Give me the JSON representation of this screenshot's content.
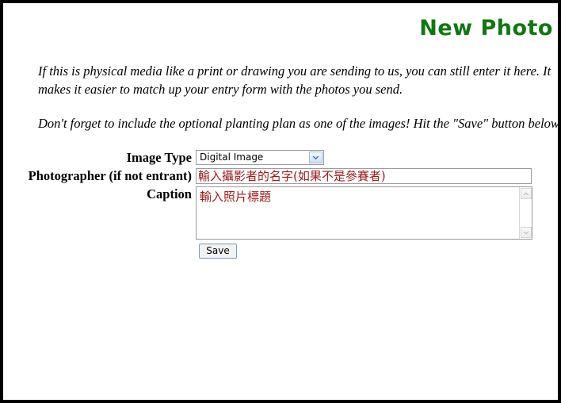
{
  "page": {
    "title": "New Photo",
    "title_color": "#117711",
    "frame_color": "#000000"
  },
  "intro": {
    "paragraph_1": "If this is physical media like a print or drawing you are sending to us, you can still enter it here. It makes it easier to match up your entry form with the photos you send.",
    "paragraph_2": "Don't forget to include the optional planting plan as one of the images! Hit the \"Save\" button below."
  },
  "form": {
    "image_type": {
      "label": "Image Type",
      "selected": "Digital Image",
      "arrow_icon": "chevron-down-icon"
    },
    "photographer": {
      "label": "Photographer (if not entrant)",
      "value": "輸入攝影者的名字(如果不是參賽者)",
      "value_color": "#9e1a1a"
    },
    "caption": {
      "label": "Caption",
      "value": "輸入照片標題",
      "value_color": "#9e1a1a",
      "scrollbar": {
        "up_icon": "chevron-up-icon",
        "down_icon": "chevron-down-icon"
      }
    },
    "save_button_label": "Save"
  }
}
